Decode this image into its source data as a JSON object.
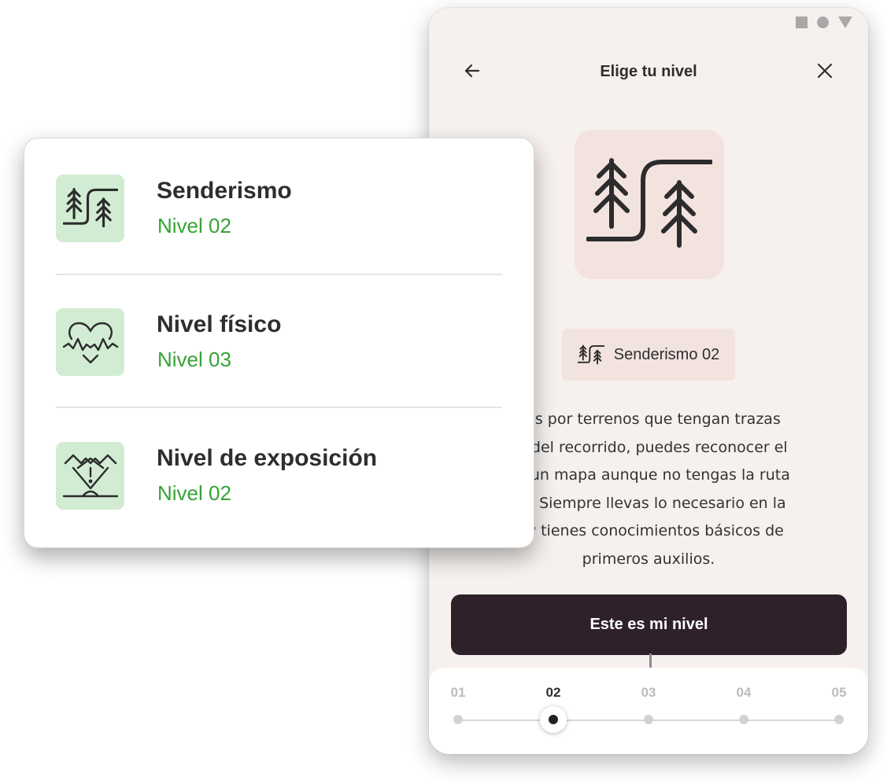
{
  "phone": {
    "header": {
      "title": "Elige tu nivel",
      "back_icon": "arrow-left-icon",
      "close_icon": "close-icon"
    },
    "hero_icon": "hiking-trees-icon",
    "chip": {
      "icon": "hiking-trees-icon",
      "label": "Senderismo 02"
    },
    "description_lines": [
      "nas por terrenos que tengan trazas",
      "es del recorrido, puedes reconocer el",
      "en un mapa aunque no tengas la ruta",
      "da. Siempre llevas lo necesario en la",
      "a y tienes conocimientos básicos de",
      "primeros auxilios."
    ],
    "cta_label": "Este es mi nivel",
    "levels": {
      "options": [
        "01",
        "02",
        "03",
        "04",
        "05"
      ],
      "selected": "02"
    }
  },
  "summary_card": {
    "items": [
      {
        "icon": "hiking-trees-icon",
        "title": "Senderismo",
        "level": "Nivel 02"
      },
      {
        "icon": "heart-pulse-icon",
        "title": "Nivel físico",
        "level": "Nivel 03"
      },
      {
        "icon": "exposure-warning-icon",
        "title": "Nivel de exposición",
        "level": "Nivel 02"
      }
    ]
  },
  "colors": {
    "phone_bg": "#f6f1ee",
    "hero_bg": "#f3e3df",
    "cta_bg": "#2f2129",
    "icon_tile_green": "#d2ecd4",
    "level_green": "#36a336",
    "text_dark": "#2e2e2e"
  }
}
